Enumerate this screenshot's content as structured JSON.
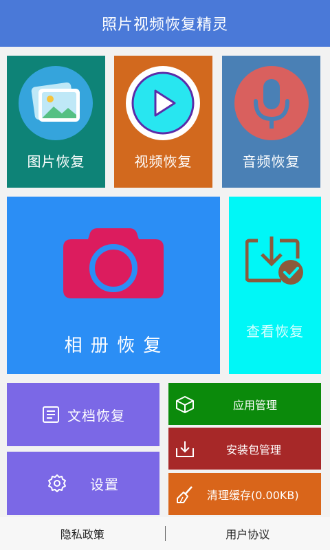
{
  "app": {
    "title": "照片视频恢复精灵"
  },
  "tiles": {
    "photo": {
      "label": "图片恢复"
    },
    "video": {
      "label": "视频恢复"
    },
    "audio": {
      "label": "音频恢复"
    },
    "album": {
      "label": "相 册 恢 复"
    },
    "view": {
      "label": "查看恢复"
    },
    "doc": {
      "label": "文档恢复"
    },
    "settings": {
      "label": "设置"
    },
    "apps": {
      "label": "应用管理"
    },
    "apk": {
      "label": "安装包管理"
    },
    "cache": {
      "label": "清理缓存(0.00KB)"
    }
  },
  "footer": {
    "privacy": "隐私政策",
    "agreement": "用户协议"
  },
  "colors": {
    "header": "#4a79d8",
    "photo": "#0e8377",
    "video": "#d2691e",
    "audio": "#4a80b5",
    "album": "#2b8ef5",
    "view": "#00f7f7",
    "doc": "#7b68e6",
    "apps": "#0b8a0b",
    "apk": "#a72828",
    "cache": "#d9651a"
  },
  "icons": [
    "image-icon",
    "play-icon",
    "microphone-icon",
    "camera-icon",
    "download-check-icon",
    "document-icon",
    "gear-icon",
    "box-icon",
    "download-tray-icon",
    "broom-icon"
  ]
}
